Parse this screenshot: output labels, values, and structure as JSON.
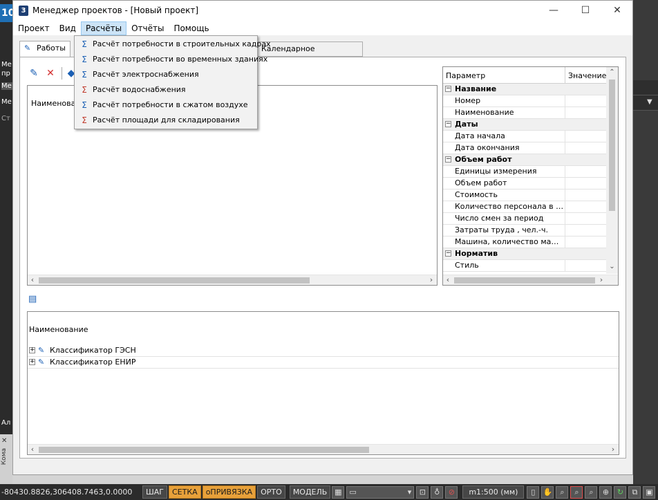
{
  "background": {
    "left_fragments": [
      "Ме",
      "пр",
      "Ме",
      "Ме",
      "Ст",
      "Ал",
      "Кома"
    ],
    "logo": "10"
  },
  "window": {
    "title": "Менеджер проектов - [Новый проект]",
    "app_icon_glyph": "3",
    "controls": {
      "minimize": "—",
      "maximize": "☐",
      "close": "✕"
    }
  },
  "menu": {
    "items": [
      "Проект",
      "Вид",
      "Расчёты",
      "Отчёты",
      "Помощь"
    ],
    "active_index": 2
  },
  "dropdown": {
    "items": [
      {
        "label": "Расчёт потребности в строительных кадрах",
        "icon": "staff-calc-icon"
      },
      {
        "label": "Расчёт потребности во временных зданиях",
        "icon": "buildings-calc-icon"
      },
      {
        "label": "Расчёт электроснабжения",
        "icon": "power-calc-icon"
      },
      {
        "label": "Расчёт водоснабжения",
        "icon": "water-calc-icon"
      },
      {
        "label": "Расчёт потребности в сжатом воздухе",
        "icon": "air-calc-icon"
      },
      {
        "label": "Расчёт площади для складирования",
        "icon": "storage-calc-icon"
      }
    ]
  },
  "tabs": {
    "works": "Работы",
    "calendar": "Календарное планирование"
  },
  "works_table": {
    "header": "Наименование"
  },
  "property_grid": {
    "col_param": "Параметр",
    "col_value": "Значение",
    "cat_name": "Название",
    "row_number": "Номер",
    "row_name": "Наименование",
    "cat_dates": "Даты",
    "row_start": "Дата начала",
    "row_end": "Дата окончания",
    "cat_volume": "Объем работ",
    "row_units": "Единицы измерения",
    "row_volume": "Объем работ",
    "row_cost": "Стоимость",
    "row_staff": "Количество персонала в см...",
    "row_shifts": "Число смен за период",
    "row_labor": "Затраты труда , чел.-ч.",
    "row_machines": "Машина, количество маш.-ч.",
    "cat_norm": "Норматив",
    "row_style": "Стиль"
  },
  "tree": {
    "header": "Наименование",
    "items": [
      "Классификатор ГЭСН",
      "Классификатор ЕНИР"
    ]
  },
  "statusbar": {
    "coords": "-80430.8826,306408.7463,0.0000",
    "snap": "ШАГ",
    "grid": "СЕТКА",
    "osnap": "оПРИВЯЗКА",
    "ortho": "ОРТО",
    "model": "МОДЕЛЬ",
    "scale": "m1:500 (мм)",
    "on_color": "#e8a13a"
  }
}
